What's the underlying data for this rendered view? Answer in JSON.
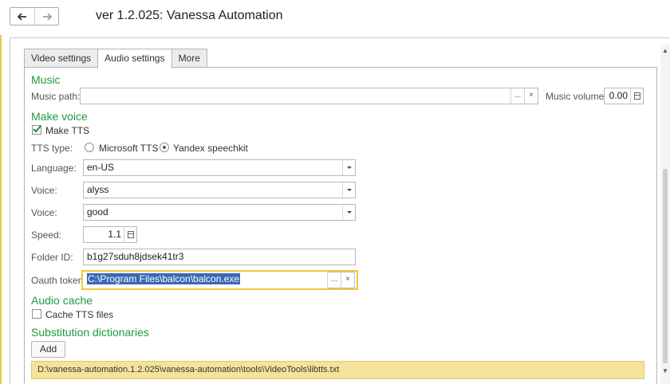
{
  "window": {
    "title": "ver 1.2.025: Vanessa Automation",
    "back_icon": "arrow-left-icon",
    "forward_icon": "arrow-right-icon"
  },
  "tabs": [
    {
      "label": "Video settings",
      "active": false
    },
    {
      "label": "Audio settings",
      "active": true
    },
    {
      "label": "More",
      "active": false
    }
  ],
  "music": {
    "section_title": "Music",
    "path_label": "Music path:",
    "path_value": "",
    "browse_label": "...",
    "clear_label": "×",
    "volume_label": "Music volume:",
    "volume_value": "0.00"
  },
  "make_voice": {
    "section_title": "Make voice",
    "make_tts_label": "Make TTS",
    "make_tts_checked": true,
    "tts_type_label": "TTS type:",
    "tts_options": [
      {
        "label": "Microsoft TTS",
        "selected": false
      },
      {
        "label": "Yandex speechkit",
        "selected": true
      }
    ],
    "language_label": "Language:",
    "language_value": "en-US",
    "voice1_label": "Voice:",
    "voice1_value": "alyss",
    "voice2_label": "Voice:",
    "voice2_value": "good",
    "speed_label": "Speed:",
    "speed_value": "1.1",
    "folder_label": "Folder ID:",
    "folder_value": "b1g27sduh8jdsek41tr3",
    "oauth_label": "Oauth token:",
    "oauth_value": "C:\\Program Files\\balcon\\balcon.exe",
    "oauth_browse": "...",
    "oauth_clear": "×"
  },
  "audio_cache": {
    "section_title": "Audio cache",
    "cache_label": "Cache TTS files",
    "cache_checked": false
  },
  "substitution": {
    "section_title": "Substitution dictionaries",
    "add_label": "Add",
    "rows": [
      "D:\\vanessa-automation.1.2.025\\vanessa-automation\\tools\\VideoTools\\libtts.txt"
    ]
  },
  "colors": {
    "section_green": "#1f9a3f",
    "focus_yellow": "#f0c93c",
    "selection_blue": "#3a68b6",
    "row_highlight": "#f5e39b"
  }
}
